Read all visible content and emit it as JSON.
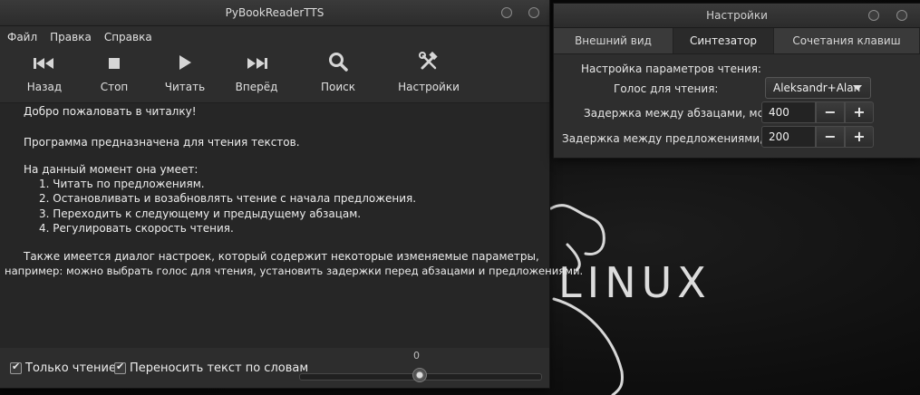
{
  "desktop": {
    "logo_text": "LINUX"
  },
  "main_window": {
    "title": "PyBookReaderTTS",
    "menu": [
      "Файл",
      "Правка",
      "Справка"
    ],
    "toolbar": [
      {
        "label": "Назад",
        "icon": "skip-back-icon"
      },
      {
        "label": "Стоп",
        "icon": "stop-icon"
      },
      {
        "label": "Читать",
        "icon": "play-icon"
      },
      {
        "label": "Вперёд",
        "icon": "skip-forward-icon"
      },
      {
        "label": "Поиск",
        "icon": "search-icon"
      },
      {
        "label": "Настройки",
        "icon": "tools-icon"
      }
    ],
    "text_lines": [
      "Добро пожаловать в читалку!",
      "",
      "Программа предназначена для чтения текстов.",
      "",
      "На данный момент она умеет:",
      "1. Читать по предложениям.",
      "2. Остановливать и возабновлять чтение с начала предложения.",
      "3. Переходить к следующему и предыдущему абзацам.",
      "4. Регулировать скорость чтения.",
      "",
      "Также имеется диалог настроек, который содержит некоторые изменяемые параметры,",
      "например: можно выбрать голос для чтения, установить задержки перед абзацами и предложениями."
    ],
    "checkboxes": [
      {
        "label": "Только чтение",
        "checked": true
      },
      {
        "label": "Переносить текст по словам",
        "checked": true
      }
    ],
    "slider": {
      "value_label": "0",
      "value": 0.5
    }
  },
  "settings_window": {
    "title": "Настройки",
    "tabs": [
      "Внешний вид",
      "Синтезатор",
      "Сочетания клавиш"
    ],
    "active_tab": "Синтезатор",
    "section_label": "Настройка параметров чтения:",
    "voice_label": "Голос для чтения:",
    "voice_value": "Aleksandr+Alan",
    "paragraph_delay_label": "Задержка между абзацами, мс:",
    "paragraph_delay_value": "400",
    "sentence_delay_label": "Задержка между предложениями, мс:",
    "sentence_delay_value": "200",
    "minus": "−",
    "plus": "+"
  }
}
